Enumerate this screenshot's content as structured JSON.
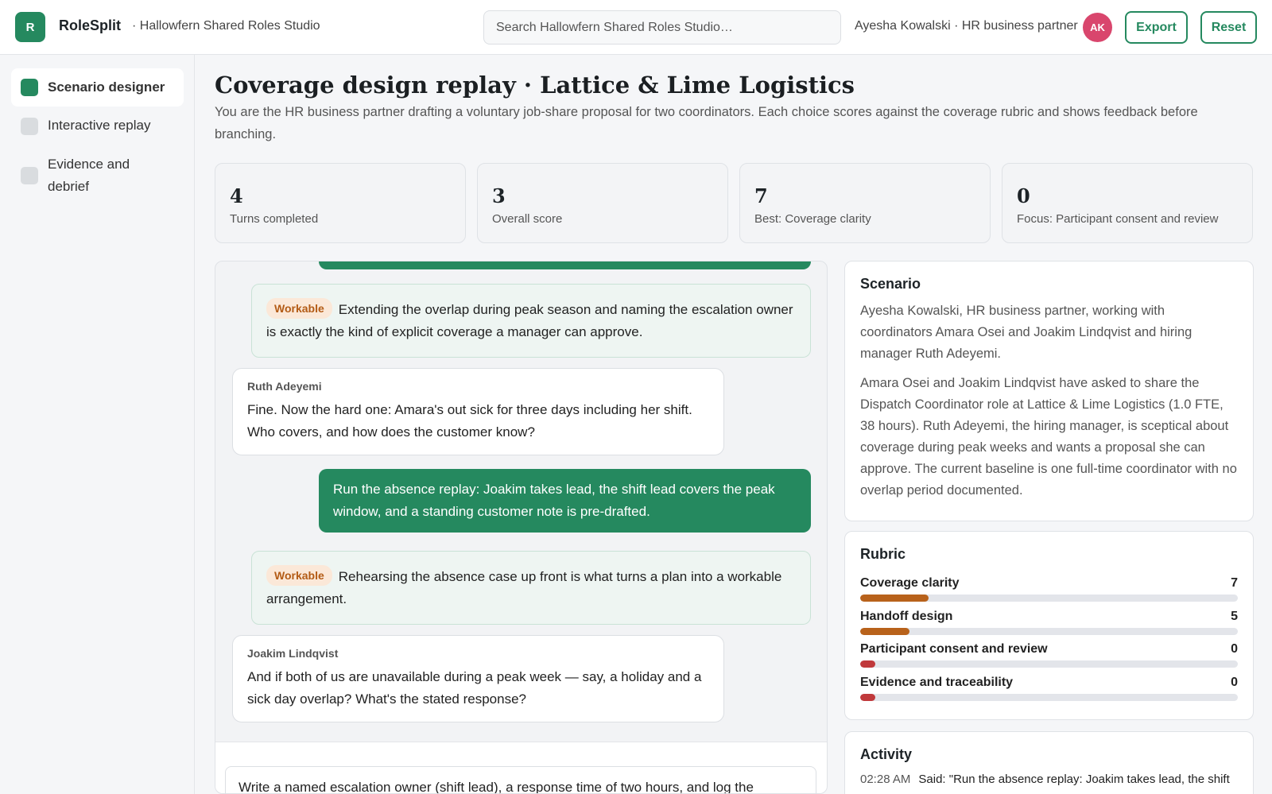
{
  "header": {
    "logo_letter": "R",
    "app_name": "RoleSplit",
    "workspace": "· Hallowfern Shared Roles Studio",
    "search_placeholder": "Search Hallowfern Shared Roles Studio…",
    "user_label": "Ayesha Kowalski · HR business partner",
    "avatar_initials": "AK",
    "export_label": "Export",
    "reset_label": "Reset"
  },
  "sidebar": {
    "items": [
      {
        "label": "Scenario designer",
        "active": true
      },
      {
        "label": "Interactive replay",
        "active": false
      },
      {
        "label": "Evidence and debrief",
        "active": false
      }
    ]
  },
  "main": {
    "title": "Coverage design replay · Lattice & Lime Logistics",
    "subtitle": "You are the HR business partner drafting a voluntary job-share proposal for two coordinators. Each choice scores against the coverage rubric and shows feedback before branching.",
    "stats": [
      {
        "value": "4",
        "label": "Turns completed"
      },
      {
        "value": "3",
        "label": "Overall score"
      },
      {
        "value": "7",
        "label": "Best: Coverage clarity"
      },
      {
        "value": "0",
        "label": "Focus: Participant consent and review"
      }
    ]
  },
  "chat": {
    "feedback1": {
      "tag": "Workable",
      "text": "Extending the overlap during peak season and naming the escalation owner is exactly the kind of explicit coverage a manager can approve."
    },
    "msg1": {
      "author": "Ruth Adeyemi",
      "text": "Fine. Now the hard one: Amara's out sick for three days including her shift. Who covers, and how does the customer know?"
    },
    "reply1": "Run the absence replay: Joakim takes lead, the shift lead covers the peak window, and a standing customer note is pre-drafted.",
    "feedback2": {
      "tag": "Workable",
      "text": "Rehearsing the absence case up front is what turns a plan into a workable arrangement."
    },
    "msg2": {
      "author": "Joakim Lindqvist",
      "text": "And if both of us are unavailable during a peak week — say, a holiday and a sick day overlap? What's the stated response?"
    },
    "composer_text": "Write a named escalation owner (shift lead), a response time of two hours, and log the"
  },
  "scenario": {
    "heading": "Scenario",
    "intro": "Ayesha Kowalski, HR business partner, working with coordinators Amara Osei and Joakim Lindqvist and hiring manager Ruth Adeyemi.",
    "body": "Amara Osei and Joakim Lindqvist have asked to share the Dispatch Coordinator role at Lattice & Lime Logistics (1.0 FTE, 38 hours). Ruth Adeyemi, the hiring manager, is sceptical about coverage during peak weeks and wants a proposal she can approve. The current baseline is one full-time coordinator with no overlap period documented."
  },
  "rubric": {
    "heading": "Rubric",
    "rows": [
      {
        "name": "Coverage clarity",
        "score": "7",
        "fill": 0.18,
        "color": "#b8621b"
      },
      {
        "name": "Handoff design",
        "score": "5",
        "fill": 0.13,
        "color": "#b8621b"
      },
      {
        "name": "Participant consent and review",
        "score": "0",
        "fill": 0.04,
        "color": "#c0393b"
      },
      {
        "name": "Evidence and traceability",
        "score": "0",
        "fill": 0.04,
        "color": "#c0393b"
      }
    ]
  },
  "activity": {
    "heading": "Activity",
    "entries": [
      {
        "time": "02:28 AM",
        "text": "Said: \"Run the absence replay: Joakim takes lead, the shift"
      }
    ]
  }
}
